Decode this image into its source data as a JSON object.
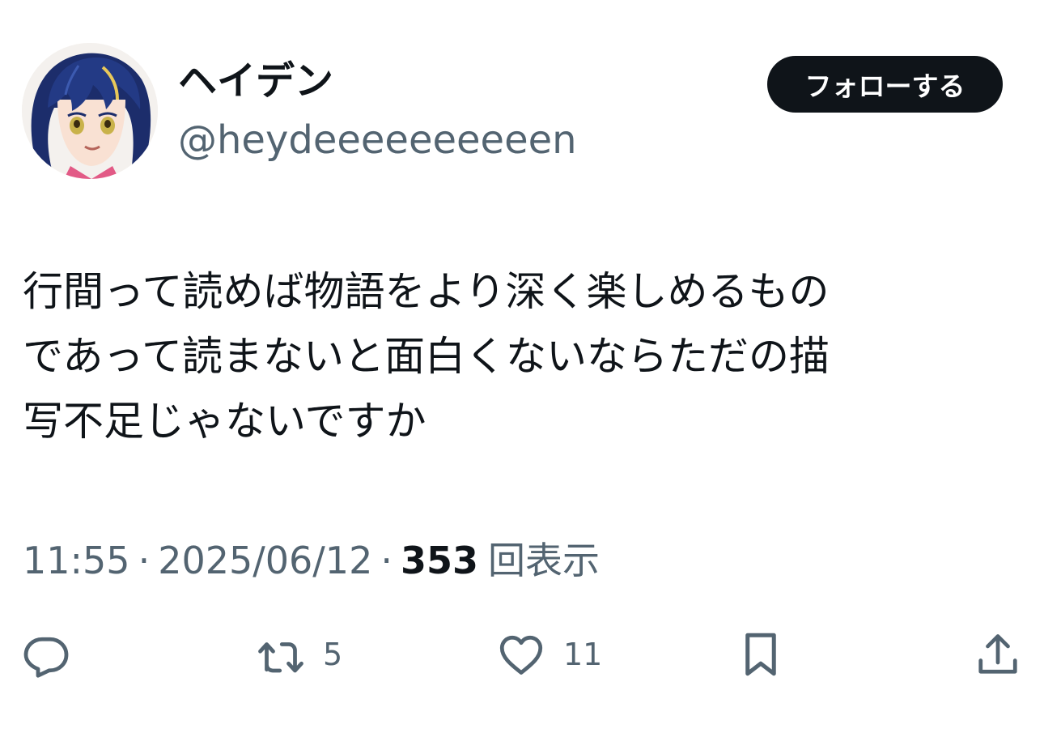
{
  "author": {
    "display_name": "ヘイデン",
    "handle": "@heydeeeeeeeeeen",
    "avatar_icon": "character-avatar-icon"
  },
  "follow_button": {
    "label": "フォローする"
  },
  "tweet": {
    "text": "行間って読めば物語をより深く楽しめるもの\nであって読まないと面白くないならただの描\n写不足じゃないですか"
  },
  "meta": {
    "time": "11:55",
    "separator": "·",
    "date": "2025/06/12",
    "views_count": "353",
    "views_label": "回表示"
  },
  "actions": {
    "reply": {
      "icon": "reply-icon"
    },
    "retweet": {
      "icon": "retweet-icon",
      "count": "5"
    },
    "like": {
      "icon": "heart-icon",
      "count": "11"
    },
    "bookmark": {
      "icon": "bookmark-icon"
    },
    "share": {
      "icon": "share-icon"
    }
  },
  "colors": {
    "text": "#0f1419",
    "secondary": "#536471",
    "button_bg": "#0f1419",
    "button_text": "#ffffff"
  }
}
